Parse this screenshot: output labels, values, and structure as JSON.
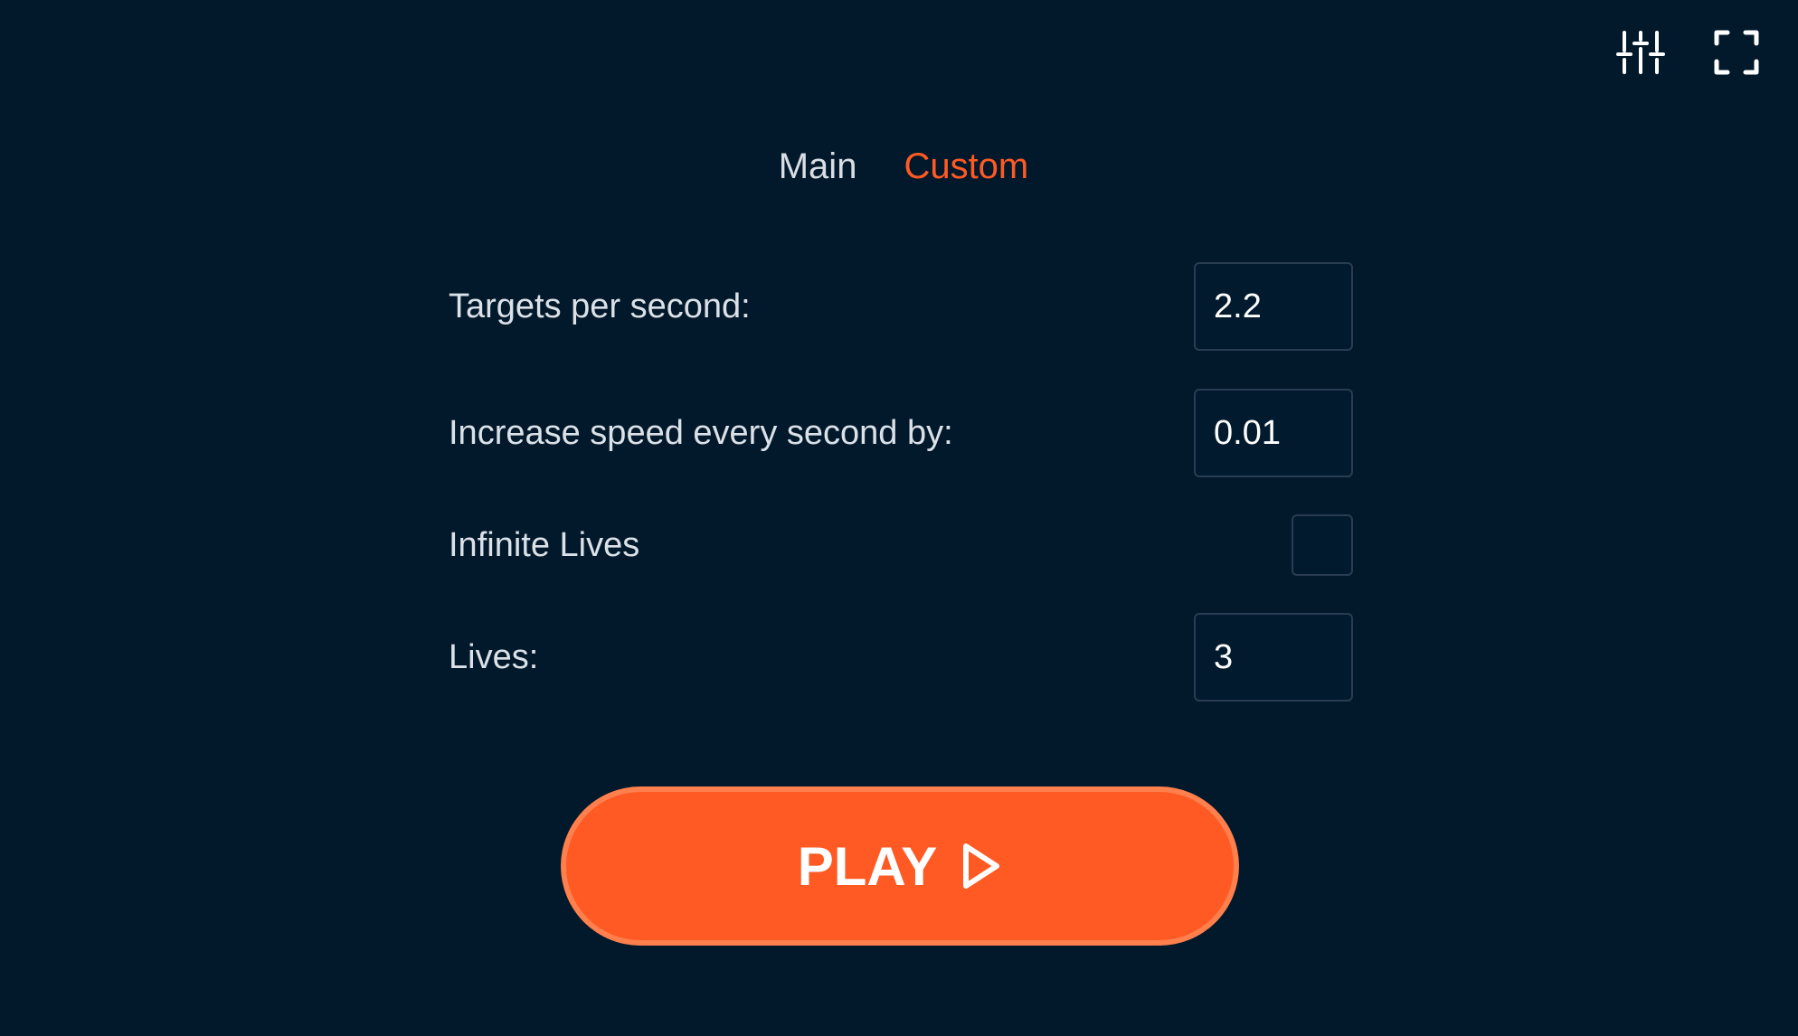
{
  "header": {
    "icons": [
      "sliders-icon",
      "fullscreen-icon"
    ]
  },
  "tabs": [
    {
      "label": "Main",
      "active": false
    },
    {
      "label": "Custom",
      "active": true
    }
  ],
  "form": {
    "targets_per_second": {
      "label": "Targets per second:",
      "value": "2.2"
    },
    "speed_increase": {
      "label": "Increase speed every second by:",
      "value": "0.01"
    },
    "infinite_lives": {
      "label": "Infinite Lives",
      "checked": false
    },
    "lives": {
      "label": "Lives:",
      "value": "3"
    }
  },
  "play": {
    "label": "PLAY"
  },
  "colors": {
    "background": "#02192b",
    "accent": "#ff5a24",
    "text": "#dbe1e8",
    "border": "#2a3c52"
  }
}
